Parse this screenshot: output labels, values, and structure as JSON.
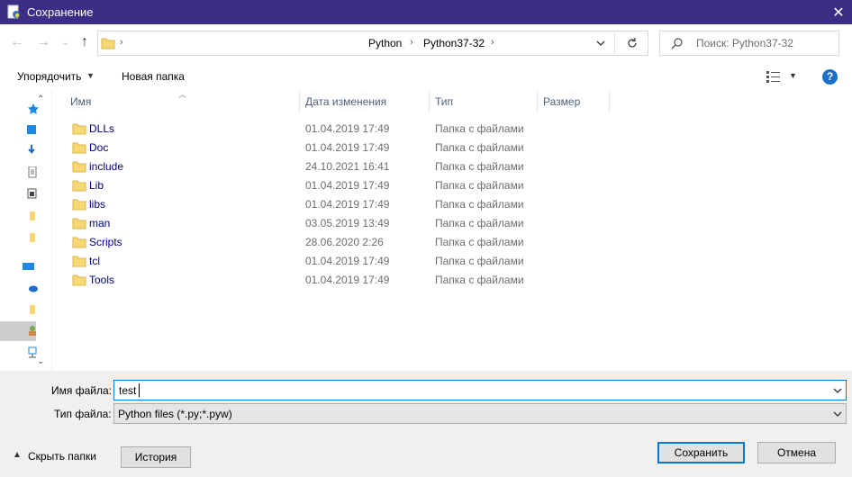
{
  "window": {
    "title": "Сохранение",
    "close_glyph": "✕"
  },
  "nav": {
    "back_glyph": "←",
    "forward_glyph": "→",
    "recent_glyph": "⌄",
    "up_glyph": "↑",
    "breadcrumbs": [
      "Python",
      "Python37-32"
    ],
    "search_placeholder": "Поиск: Python37-32"
  },
  "toolbar": {
    "organize_label": "Упорядочить",
    "new_folder_label": "Новая папка",
    "help_label": "?"
  },
  "columns": {
    "name": "Имя",
    "date": "Дата изменения",
    "type": "Тип",
    "size": "Размер"
  },
  "files": [
    {
      "name": "DLLs",
      "date": "01.04.2019 17:49",
      "type": "Папка с файлами"
    },
    {
      "name": "Doc",
      "date": "01.04.2019 17:49",
      "type": "Папка с файлами"
    },
    {
      "name": "include",
      "date": "24.10.2021 16:41",
      "type": "Папка с файлами"
    },
    {
      "name": "Lib",
      "date": "01.04.2019 17:49",
      "type": "Папка с файлами"
    },
    {
      "name": "libs",
      "date": "01.04.2019 17:49",
      "type": "Папка с файлами"
    },
    {
      "name": "man",
      "date": "03.05.2019 13:49",
      "type": "Папка с файлами"
    },
    {
      "name": "Scripts",
      "date": "28.06.2020 2:26",
      "type": "Папка с файлами"
    },
    {
      "name": "tcl",
      "date": "01.04.2019 17:49",
      "type": "Папка с файлами"
    },
    {
      "name": "Tools",
      "date": "01.04.2019 17:49",
      "type": "Папка с файлами"
    }
  ],
  "form": {
    "filename_label": "Имя файла:",
    "filename_value": "test",
    "filetype_label": "Тип файла:",
    "filetype_value": "Python files (*.py;*.pyw)"
  },
  "footer": {
    "hide_folders_label": "Скрыть папки",
    "history_label": "История",
    "save_label": "Сохранить",
    "cancel_label": "Отмена"
  },
  "colors": {
    "titlebar": "#3b2e84",
    "accent": "#0078d7",
    "folder": "#f8d775",
    "link_text": "#000080"
  }
}
